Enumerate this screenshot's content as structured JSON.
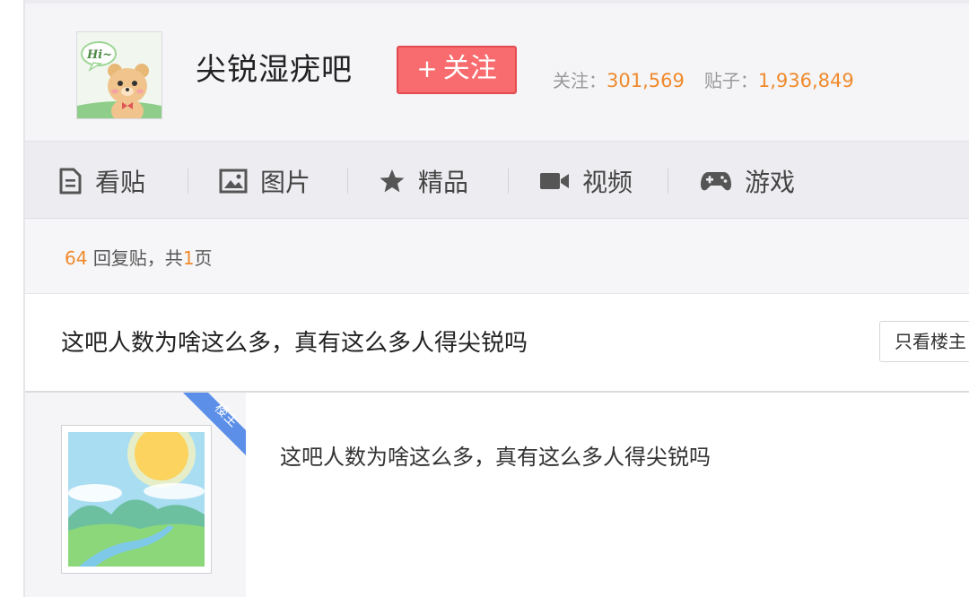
{
  "forum": {
    "avatar_badge": "Hi~",
    "name": "尖锐湿疣吧",
    "follow_label": "关注",
    "follow_plus": "+",
    "stats": {
      "followers_label": "关注：",
      "followers_value": "301,569",
      "posts_label": "贴子：",
      "posts_value": "1,936,849"
    }
  },
  "nav": {
    "items": [
      {
        "label": "看贴",
        "icon": "document-icon"
      },
      {
        "label": "图片",
        "icon": "picture-icon"
      },
      {
        "label": "精品",
        "icon": "star-icon"
      },
      {
        "label": "视频",
        "icon": "video-camera-icon"
      },
      {
        "label": "游戏",
        "icon": "gamepad-icon"
      }
    ]
  },
  "reply_summary": {
    "count": "64",
    "count_suffix": "回复贴，共",
    "pages": "1",
    "pages_suffix": "页"
  },
  "thread": {
    "title": "这吧人数为啥这么多，真有这么多人得尖锐吗",
    "only_op_label": "只看楼主"
  },
  "post": {
    "op_badge": "楼主",
    "content": "这吧人数为啥这么多，真有这么多人得尖锐吗"
  },
  "colors": {
    "accent_orange": "#f08a2c",
    "follow_red": "#f86b6e",
    "op_ribbon_blue": "#5b8fe8"
  }
}
